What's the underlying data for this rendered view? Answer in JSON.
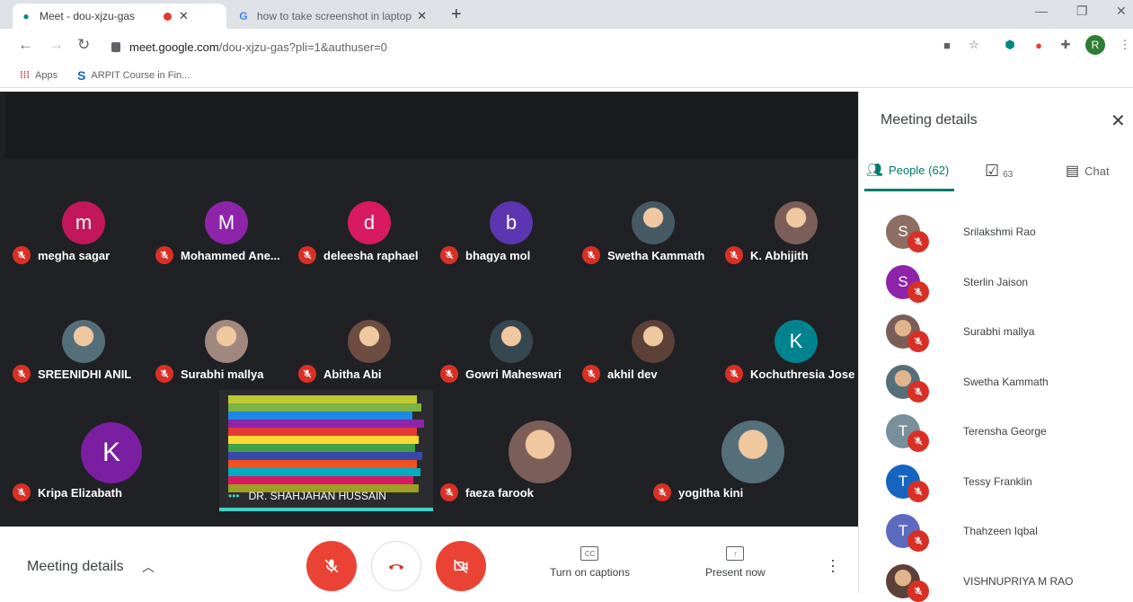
{
  "browser": {
    "tabs": [
      {
        "title": "Meet - dou-xjzu-gas"
      },
      {
        "title": "how to take screenshot in laptop"
      }
    ],
    "url_host": "meet.google.com",
    "url_path": "/dou-xjzu-gas?pli=1&authuser=0",
    "bookmarks": [
      {
        "label": "Apps"
      },
      {
        "label": "ARPIT Course in Fin..."
      }
    ],
    "profile_initial": "R"
  },
  "participants": [
    {
      "name": "megha sagar",
      "initial": "m",
      "color": "#c2185b"
    },
    {
      "name": "Mohammed Ane...",
      "initial": "M",
      "color": "#8e24aa"
    },
    {
      "name": "deleesha raphael",
      "initial": "d",
      "color": "#d81b60"
    },
    {
      "name": "bhagya mol",
      "initial": "b",
      "color": "#5e35b1"
    },
    {
      "name": "Swetha Kammath",
      "initial": ""
    },
    {
      "name": "K. Abhijith",
      "initial": ""
    },
    {
      "name": "SREENIDHI ANIL",
      "initial": ""
    },
    {
      "name": "Surabhi mallya",
      "initial": ""
    },
    {
      "name": "Abitha Abi",
      "initial": ""
    },
    {
      "name": "Gowri Maheswari",
      "initial": ""
    },
    {
      "name": "akhil dev",
      "initial": ""
    },
    {
      "name": "Kochuthresia Jose",
      "initial": "K",
      "color": "#00838f"
    },
    {
      "name": "Kripa Elizabath",
      "initial": "K",
      "color": "#7b1fa2"
    },
    {
      "name": "faeza farook",
      "initial": ""
    },
    {
      "name": "yogitha kini",
      "initial": ""
    }
  ],
  "presenter": {
    "name": "DR. SHAHJAHAN HUSSAIN",
    "dots": "•••"
  },
  "bottom_bar": {
    "meeting_details": "Meeting details",
    "captions": "Turn on captions",
    "captions_icon": "CC",
    "present": "Present now"
  },
  "sidebar": {
    "title": "Meeting details",
    "tabs": [
      {
        "label": "People (62)"
      },
      {
        "label": "63"
      },
      {
        "label": "Chat"
      }
    ],
    "people": [
      {
        "name": "Srilakshmi Rao",
        "initial": "S",
        "color": "#8d6e63"
      },
      {
        "name": "Sterlin Jaison",
        "initial": "S",
        "color": "#8e24aa"
      },
      {
        "name": "Surabhi mallya",
        "initial": ""
      },
      {
        "name": "Swetha Kammath",
        "initial": ""
      },
      {
        "name": "Terensha George",
        "initial": "T",
        "color": "#78909c"
      },
      {
        "name": "Tessy Franklin",
        "initial": "T",
        "color": "#1565c0"
      },
      {
        "name": "Thahzeen Iqbal",
        "initial": "T",
        "color": "#5c6bc0"
      },
      {
        "name": "VISHNUPRIYA M RAO",
        "initial": ""
      }
    ]
  }
}
